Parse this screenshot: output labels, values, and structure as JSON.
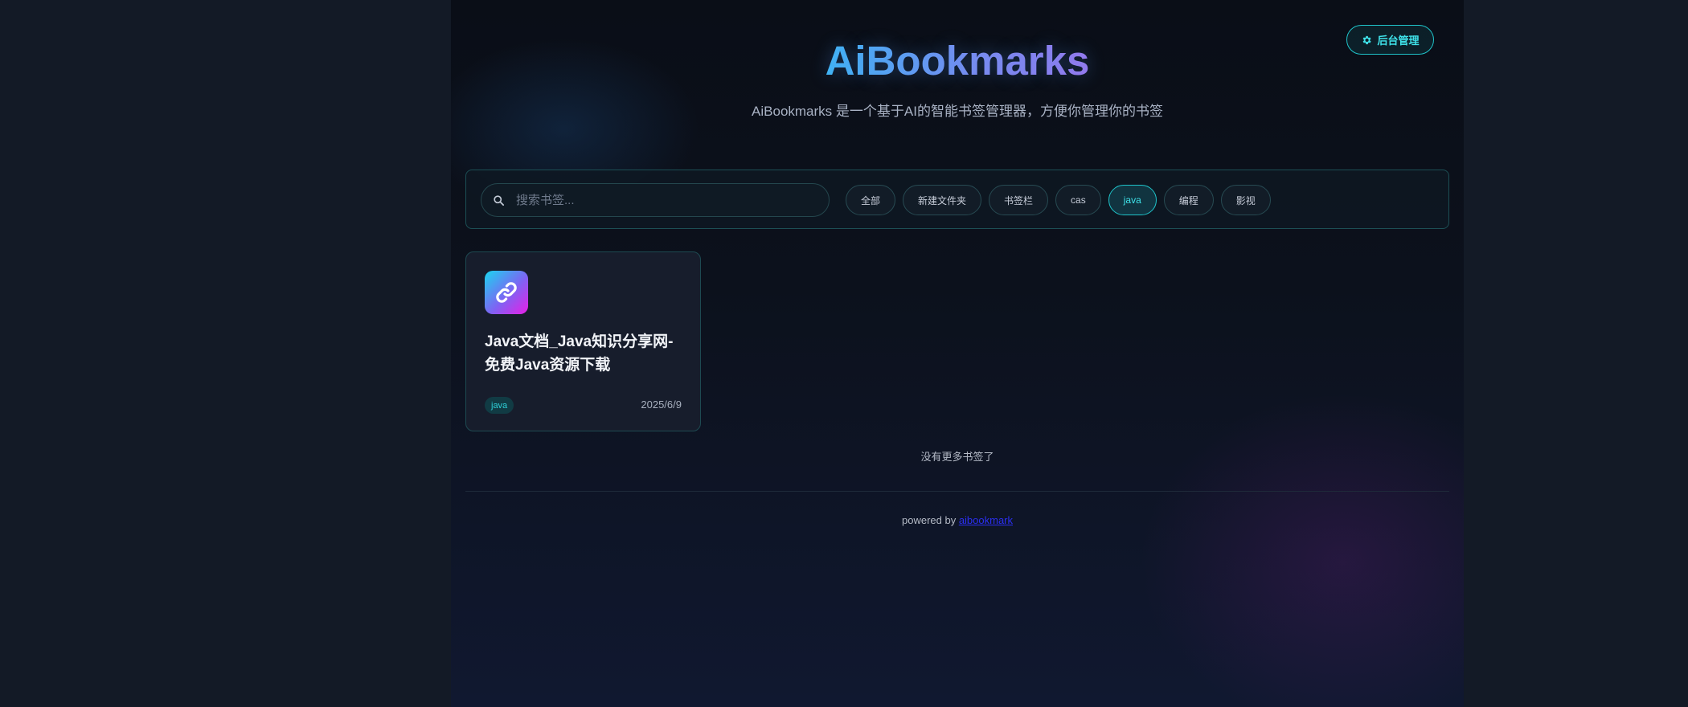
{
  "header": {
    "admin_button_label": "后台管理",
    "title": "AiBookmarks",
    "subtitle": "AiBookmarks 是一个基于AI的智能书签管理器，方便你管理你的书签"
  },
  "search": {
    "placeholder": "搜索书签...",
    "value": ""
  },
  "categories": [
    {
      "label": "全部",
      "active": false
    },
    {
      "label": "新建文件夹",
      "active": false
    },
    {
      "label": "书签栏",
      "active": false
    },
    {
      "label": "cas",
      "active": false
    },
    {
      "label": "java",
      "active": true
    },
    {
      "label": "编程",
      "active": false
    },
    {
      "label": "影视",
      "active": false
    }
  ],
  "bookmarks": [
    {
      "icon": "link-icon",
      "title": "Java文档_Java知识分享网-免费Java资源下载",
      "tag": "java",
      "date": "2025/6/9"
    }
  ],
  "status": {
    "no_more": "没有更多书签了"
  },
  "footer": {
    "prefix": "powered by ",
    "link_text": "aibookmark"
  },
  "colors": {
    "accent": "#1fc3c9",
    "background": "#0c111c",
    "link": "#2a2ff0"
  }
}
